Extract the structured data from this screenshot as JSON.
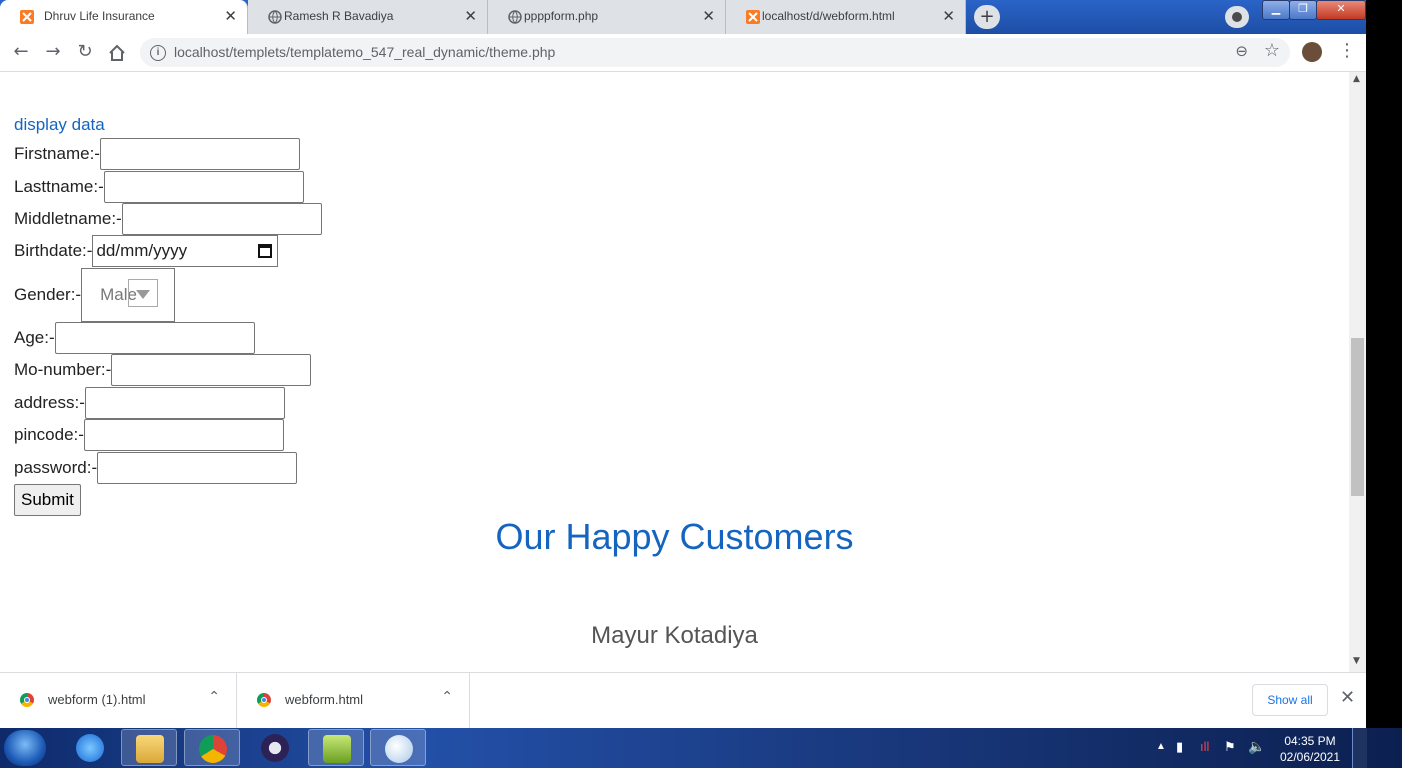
{
  "browser": {
    "tabs": [
      {
        "title": "Dhruv Life Insurance",
        "icon": "xampp-icon",
        "active": true
      },
      {
        "title": "Ramesh R Bavadiya",
        "icon": "globe-icon",
        "active": false
      },
      {
        "title": "ppppform.php",
        "icon": "globe-icon",
        "active": false
      },
      {
        "title": "localhost/d/webform.html",
        "icon": "xampp-icon",
        "active": false
      }
    ],
    "new_tab": "+",
    "url": "localhost/templets/templatemo_547_real_dynamic/theme.php"
  },
  "page": {
    "display_link": "display data",
    "fields": {
      "firstname": "Firstname:-",
      "lastname": "Lasttname:-",
      "middlename": "Middletname:-",
      "birthdate": "Birthdate:-",
      "birthdate_placeholder": "dd/mm/yyyy",
      "gender": "Gender:-",
      "gender_value": "Male",
      "age": "Age:-",
      "mobile": "Mo-number:-",
      "address": "address:-",
      "pincode": "pincode:-",
      "password": "password:-"
    },
    "submit": "Submit",
    "heading": "Our Happy Customers",
    "customer_name": "Mayur Kotadiya"
  },
  "downloads": {
    "items": [
      "webform (1).html",
      "webform.html"
    ],
    "show_all": "Show all"
  },
  "taskbar": {
    "time": "04:35 PM",
    "date": "02/06/2021"
  },
  "colors": {
    "link": "#1565c0",
    "heading": "#1565c0",
    "taskbar": "#1d3f8a"
  }
}
